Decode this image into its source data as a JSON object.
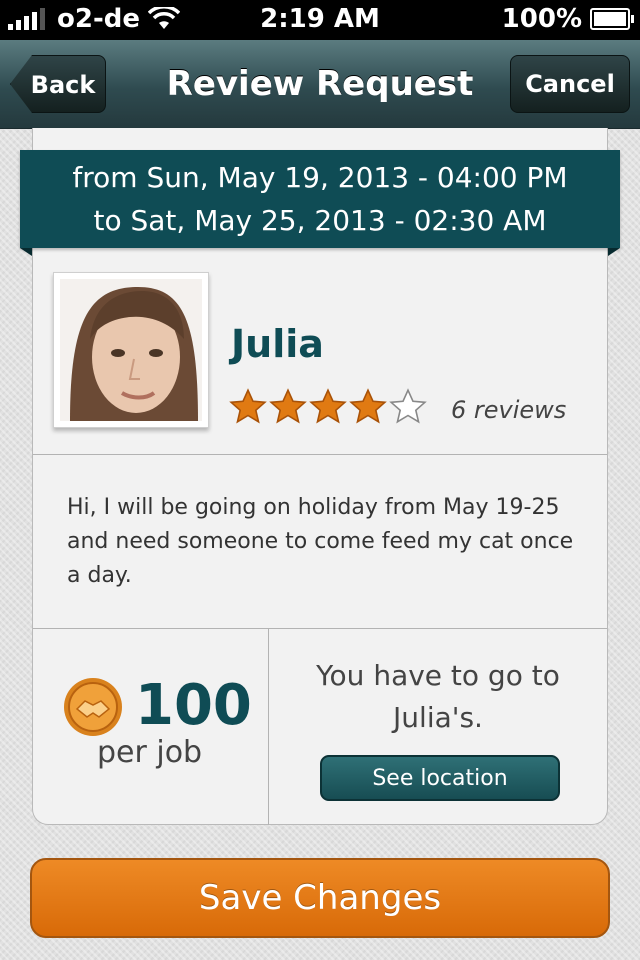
{
  "status_bar": {
    "carrier": "o2-de",
    "time": "2:19 AM",
    "battery": "100%"
  },
  "nav": {
    "back_label": "Back",
    "title": "Review Request",
    "cancel_label": "Cancel"
  },
  "date_range": {
    "from": "from Sun, May 19, 2013 - 04:00 PM",
    "to": "to Sat, May 25, 2013 - 02:30 AM"
  },
  "profile": {
    "name": "Julia",
    "rating": 4,
    "max_rating": 5,
    "reviews": "6 reviews"
  },
  "message": "Hi, I will be going on holiday from May 19-25 and need someone to come feed my cat once a day.",
  "payment": {
    "amount": "100",
    "unit": "per job"
  },
  "location": {
    "line1": "You have to go to",
    "line2": "Julia's.",
    "button_label": "See location"
  },
  "save_label": "Save Changes",
  "colors": {
    "teal": "#0f4c55",
    "orange": "#e07a12",
    "star": "#e07a12"
  }
}
